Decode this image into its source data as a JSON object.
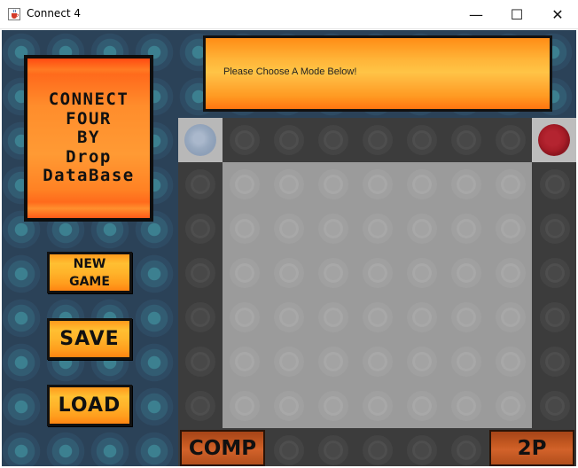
{
  "window": {
    "title": "Connect 4",
    "minimize": "—",
    "maximize": "☐",
    "close": "✕"
  },
  "logo": {
    "lines": [
      "CONNECT",
      "FOUR",
      "BY",
      "Drop",
      "DataBase"
    ]
  },
  "buttons": {
    "new_game": [
      "NEW",
      "GAME"
    ],
    "save": "SAVE",
    "load": "LOAD",
    "comp": "COMP",
    "two_player": "2P"
  },
  "message": "Please Choose A Mode Below!",
  "board": {
    "columns": 7,
    "rows": 6,
    "selector_pieces": {
      "left": "blue",
      "right": "red"
    }
  },
  "colors": {
    "background": "#2b4258",
    "logo_orange": "#ff8d2c",
    "button_orange": "#ffb42a",
    "board_dark": "#3c3c3c",
    "board_light": "#9b9b9b",
    "piece_red": "#a71c27",
    "piece_blue": "#98a9bf",
    "mode_button": "#c75a22"
  },
  "icons": {
    "app": "java-cup-icon"
  }
}
